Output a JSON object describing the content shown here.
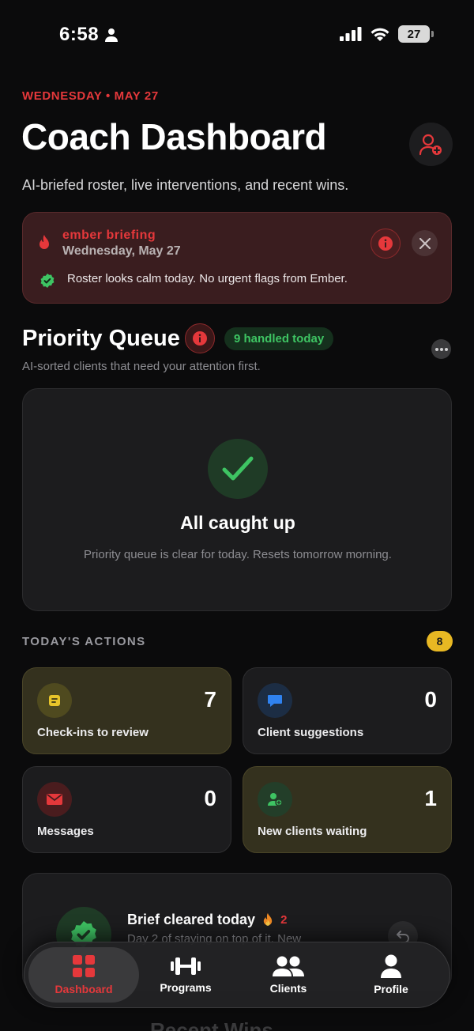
{
  "status_bar": {
    "time": "6:58",
    "battery": "27"
  },
  "header": {
    "date": "WEDNESDAY • MAY 27",
    "title": "Coach Dashboard",
    "subtitle": "AI-briefed roster, live interventions, and recent wins."
  },
  "briefing": {
    "title": "ember briefing",
    "date": "Wednesday, May 27",
    "message": "Roster looks calm today. No urgent flags from Ember."
  },
  "priority_queue": {
    "title": "Priority Queue",
    "handled": "9 handled today",
    "subtitle": "AI-sorted clients that need your attention first.",
    "empty_title": "All caught up",
    "empty_desc": "Priority queue is clear for today. Resets tomorrow morning."
  },
  "actions": {
    "header": "TODAY'S ACTIONS",
    "badge": "8",
    "items": [
      {
        "label": "Check-ins to review",
        "count": "7",
        "icon": "clipboard-icon"
      },
      {
        "label": "Client suggestions",
        "count": "0",
        "icon": "chat-bubble-icon"
      },
      {
        "label": "Messages",
        "count": "0",
        "icon": "envelope-icon"
      },
      {
        "label": "New clients waiting",
        "count": "1",
        "icon": "user-plus-icon"
      }
    ]
  },
  "brief_cleared": {
    "title": "Brief cleared today",
    "streak": "2",
    "desc": "Day 2 of staying on top of it. New"
  },
  "recent_wins": {
    "title": "Recent Wins"
  },
  "tabs": [
    {
      "label": "Dashboard",
      "icon": "grid-icon",
      "active": true
    },
    {
      "label": "Programs",
      "icon": "dumbbell-icon",
      "active": false
    },
    {
      "label": "Clients",
      "icon": "users-icon",
      "active": false
    },
    {
      "label": "Profile",
      "icon": "person-icon",
      "active": false
    }
  ],
  "colors": {
    "accent": "#e5383b",
    "success": "#3ec463",
    "warning": "#e8b823",
    "background": "#0b0b0c",
    "card": "#1c1c1e"
  }
}
